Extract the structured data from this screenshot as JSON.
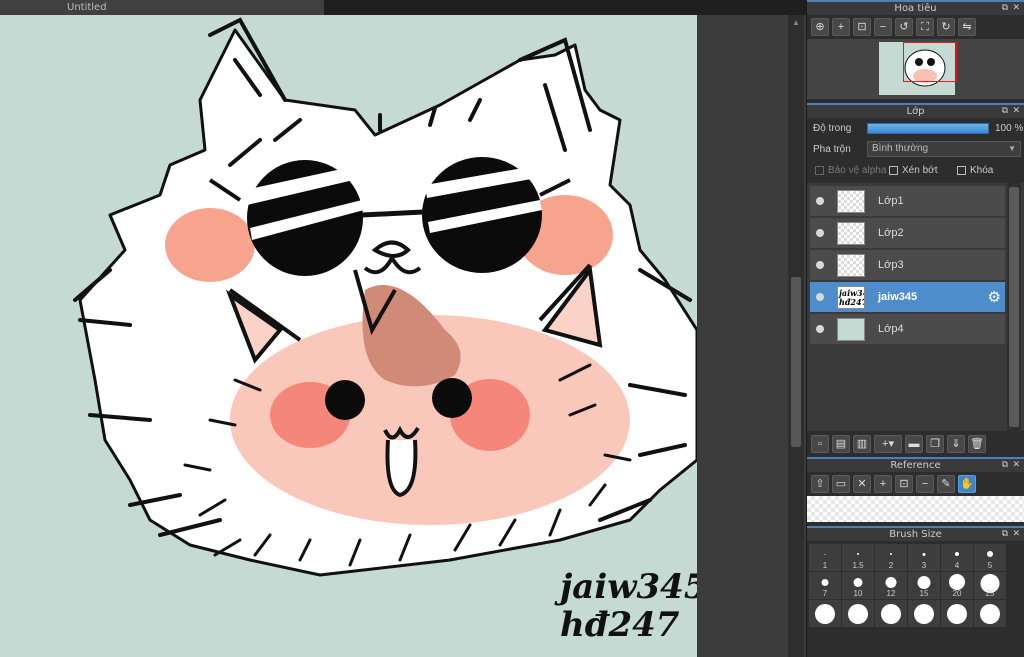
{
  "document": {
    "tab_title": "Untitled"
  },
  "artwork": {
    "signature_line1": "jaiw345",
    "signature_line2": "hđ247"
  },
  "navigator": {
    "title": "Hoa tiêu",
    "tools": [
      "zoom-fit-icon",
      "zoom-in-icon",
      "fit-window-icon",
      "zoom-out-icon",
      "rotate-left-icon",
      "fullscreen-icon",
      "rotate-right-icon",
      "flip-icon"
    ]
  },
  "layers_panel": {
    "title": "Lớp",
    "opacity_label": "Độ trong",
    "opacity_value": "100 %",
    "opacity_fraction": 1.0,
    "blend_label": "Pha trộn",
    "blend_value": "Bình thường",
    "protect_alpha": "Bảo vệ alpha",
    "clipping": "Xén bớt",
    "lock": "Khóa",
    "layers": [
      {
        "name": "Lớp1",
        "thumb": "sketch"
      },
      {
        "name": "Lớp2",
        "thumb": "blank"
      },
      {
        "name": "Lớp3",
        "thumb": "blank"
      },
      {
        "name": "jaiw345",
        "thumb": "text",
        "thumb_text": "jaiw345 hđ247",
        "selected": true
      },
      {
        "name": "Lớp4",
        "thumb": "bg"
      }
    ]
  },
  "reference_panel": {
    "title": "Reference"
  },
  "brush_size_panel": {
    "title": "Brush Size",
    "sizes": [
      "1",
      "1.5",
      "2",
      "3",
      "4",
      "5",
      "7",
      "10",
      "12",
      "15",
      "20",
      "25",
      "",
      "",
      "",
      "",
      "",
      ""
    ]
  },
  "colors": {
    "canvas_bg": "#c4dad3",
    "accent": "#4a82b8",
    "selected_layer": "#4e8ccc",
    "blush": "#f4a08a"
  }
}
